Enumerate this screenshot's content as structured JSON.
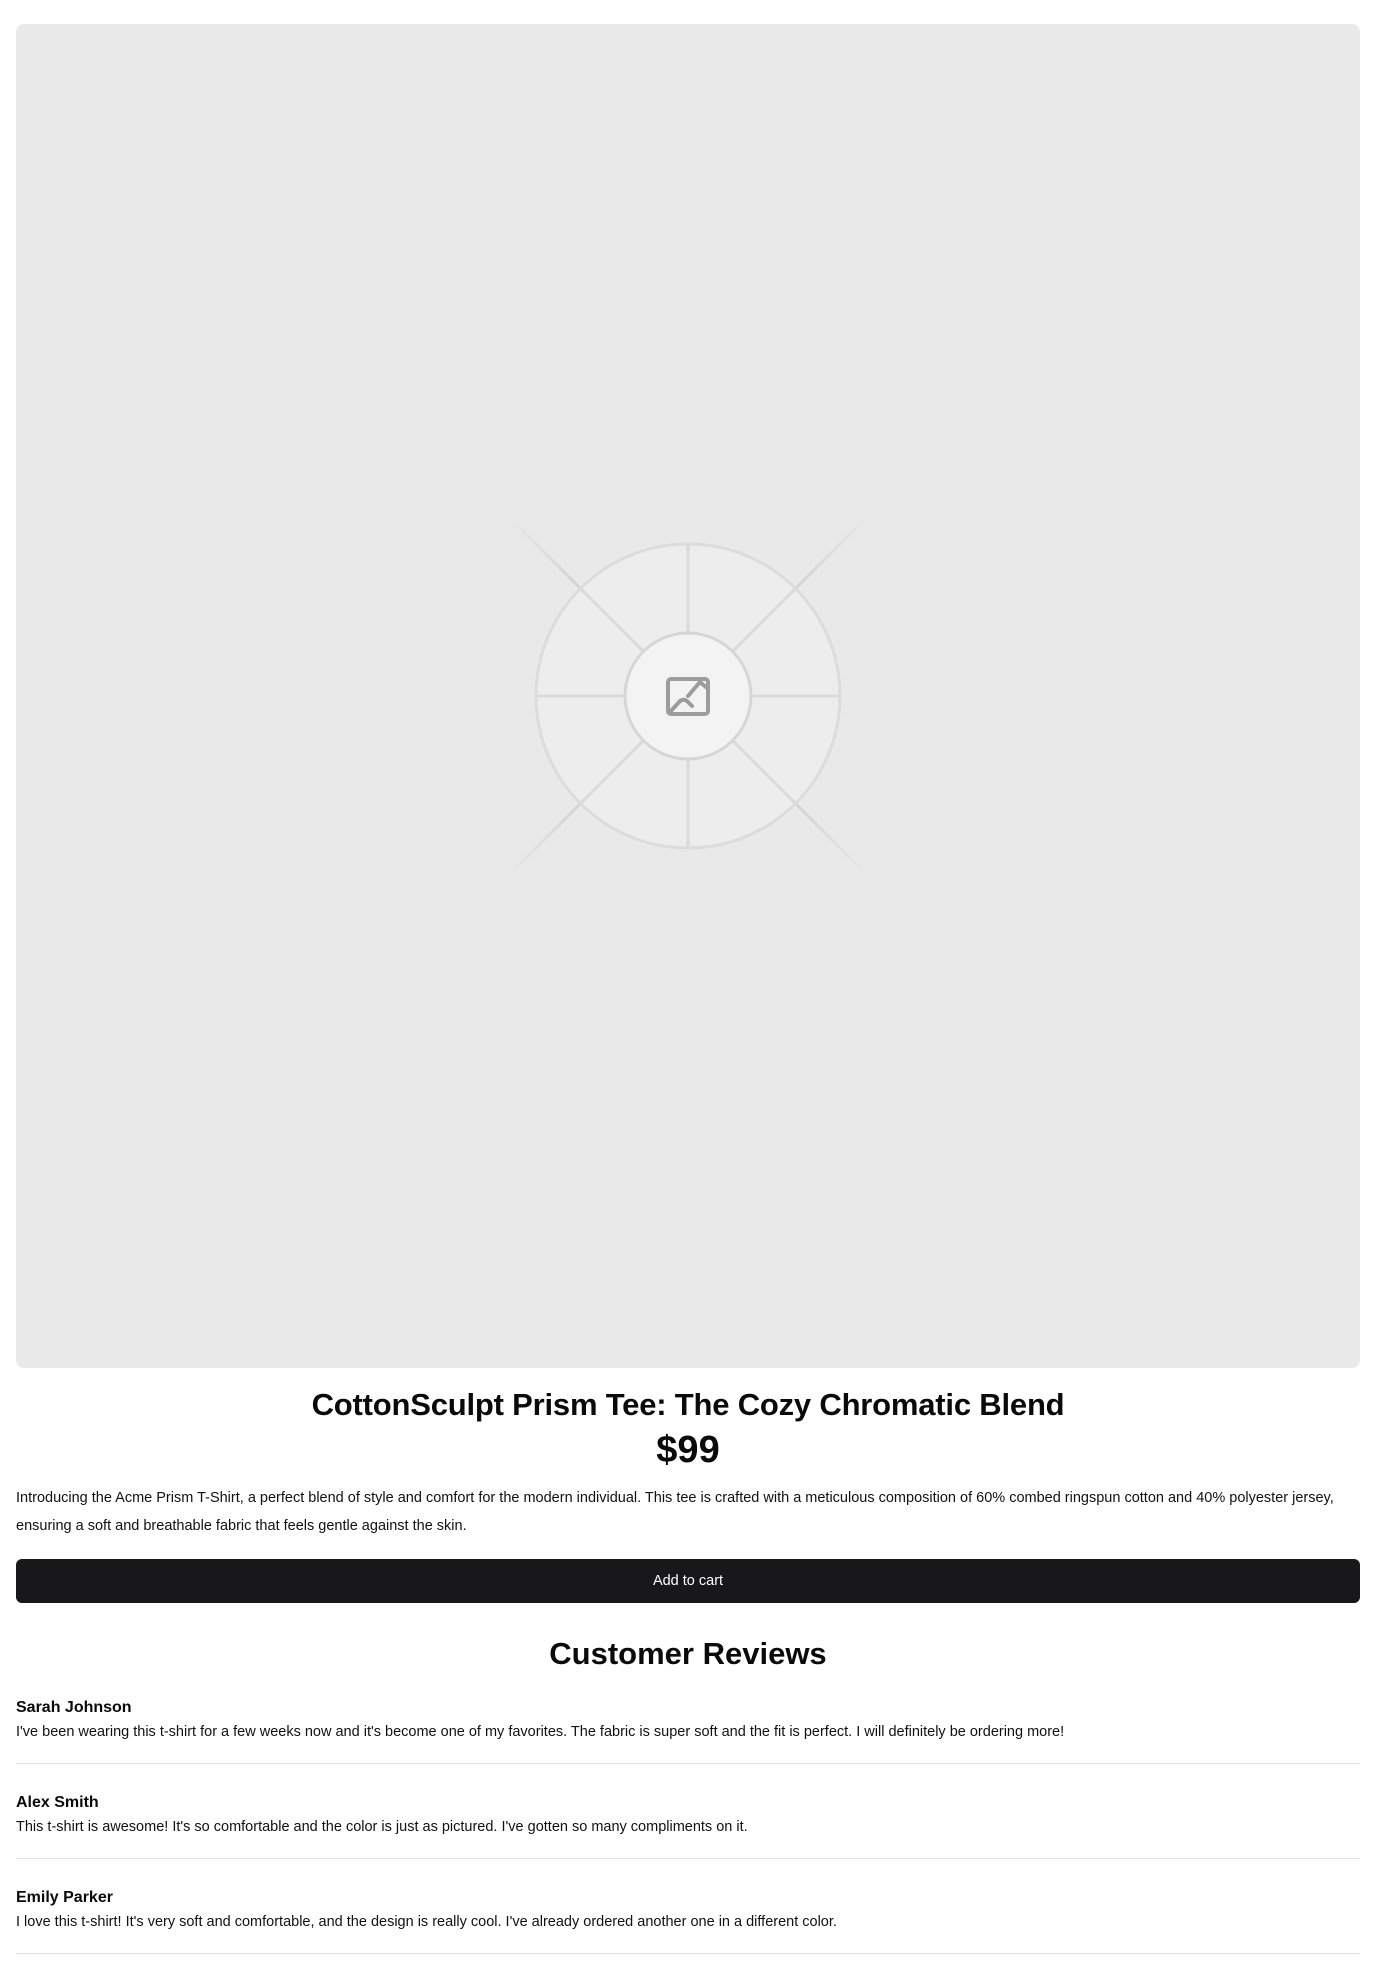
{
  "product": {
    "image_icon": "image-placeholder-icon",
    "title": "CottonSculpt Prism Tee: The Cozy Chromatic Blend",
    "price": "$99",
    "description": "Introducing the Acme Prism T-Shirt, a perfect blend of style and comfort for the modern individual. This tee is crafted with a meticulous composition of 60% combed ringspun cotton and 40% polyester jersey, ensuring a soft and breathable fabric that feels gentle against the skin.",
    "add_to_cart_label": "Add to cart"
  },
  "reviews": {
    "heading": "Customer Reviews",
    "items": [
      {
        "author": "Sarah Johnson",
        "text": "I've been wearing this t-shirt for a few weeks now and it's become one of my favorites. The fabric is super soft and the fit is perfect. I will definitely be ordering more!"
      },
      {
        "author": "Alex Smith",
        "text": "This t-shirt is awesome! It's so comfortable and the color is just as pictured. I've gotten so many compliments on it."
      },
      {
        "author": "Emily Parker",
        "text": "I love this t-shirt! It's very soft and comfortable, and the design is really cool. I've already ordered another one in a different color."
      }
    ]
  },
  "colors": {
    "image_bg": "#e9e9e9",
    "button_bg": "#18181a",
    "button_text": "#ffffff",
    "divider": "#e2e2e2"
  }
}
